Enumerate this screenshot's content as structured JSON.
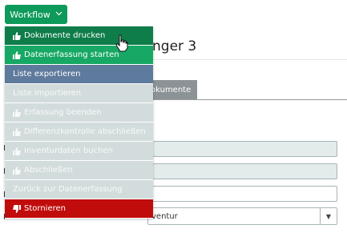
{
  "workflow_button": {
    "label": "Workflow",
    "icon": "chevron-down-icon"
  },
  "page": {
    "title": "nger 3",
    "tab_label": "okumente",
    "select_value": "ventur",
    "side_labels": [
      "I",
      "I",
      "B",
      "I"
    ]
  },
  "menu": {
    "items": [
      {
        "label": "Dokumente drucken",
        "icon": "thumbs-up-icon",
        "style": "green-dark",
        "enabled": true
      },
      {
        "label": "Datenerfassung starten",
        "icon": "thumbs-up-icon",
        "style": "green",
        "enabled": true
      },
      {
        "label": "Liste exportieren",
        "icon": "",
        "style": "blue",
        "enabled": true
      },
      {
        "label": "Liste importieren",
        "icon": "",
        "style": "grey",
        "enabled": false
      },
      {
        "label": "Erfassung beenden",
        "icon": "thumbs-up-icon",
        "style": "grey",
        "enabled": false
      },
      {
        "label": "Differenzkontrolle abschließen",
        "icon": "thumbs-up-icon",
        "style": "grey",
        "enabled": false
      },
      {
        "label": "Inventurdaten buchen",
        "icon": "thumbs-up-icon",
        "style": "grey",
        "enabled": false
      },
      {
        "label": "Abschließen",
        "icon": "thumbs-up-icon",
        "style": "grey",
        "enabled": false
      },
      {
        "label": "Zurück zur Datenerfassung",
        "icon": "",
        "style": "grey",
        "enabled": false
      },
      {
        "label": "Stornieren",
        "icon": "thumbs-down-icon",
        "style": "red",
        "enabled": true
      }
    ]
  },
  "colors": {
    "workflow": "#0d9a5a",
    "green_dark": "#0e7d4a",
    "green": "#17a865",
    "blue": "#5e7a9d",
    "grey": "#d3dcdc",
    "red": "#c10c0c"
  }
}
